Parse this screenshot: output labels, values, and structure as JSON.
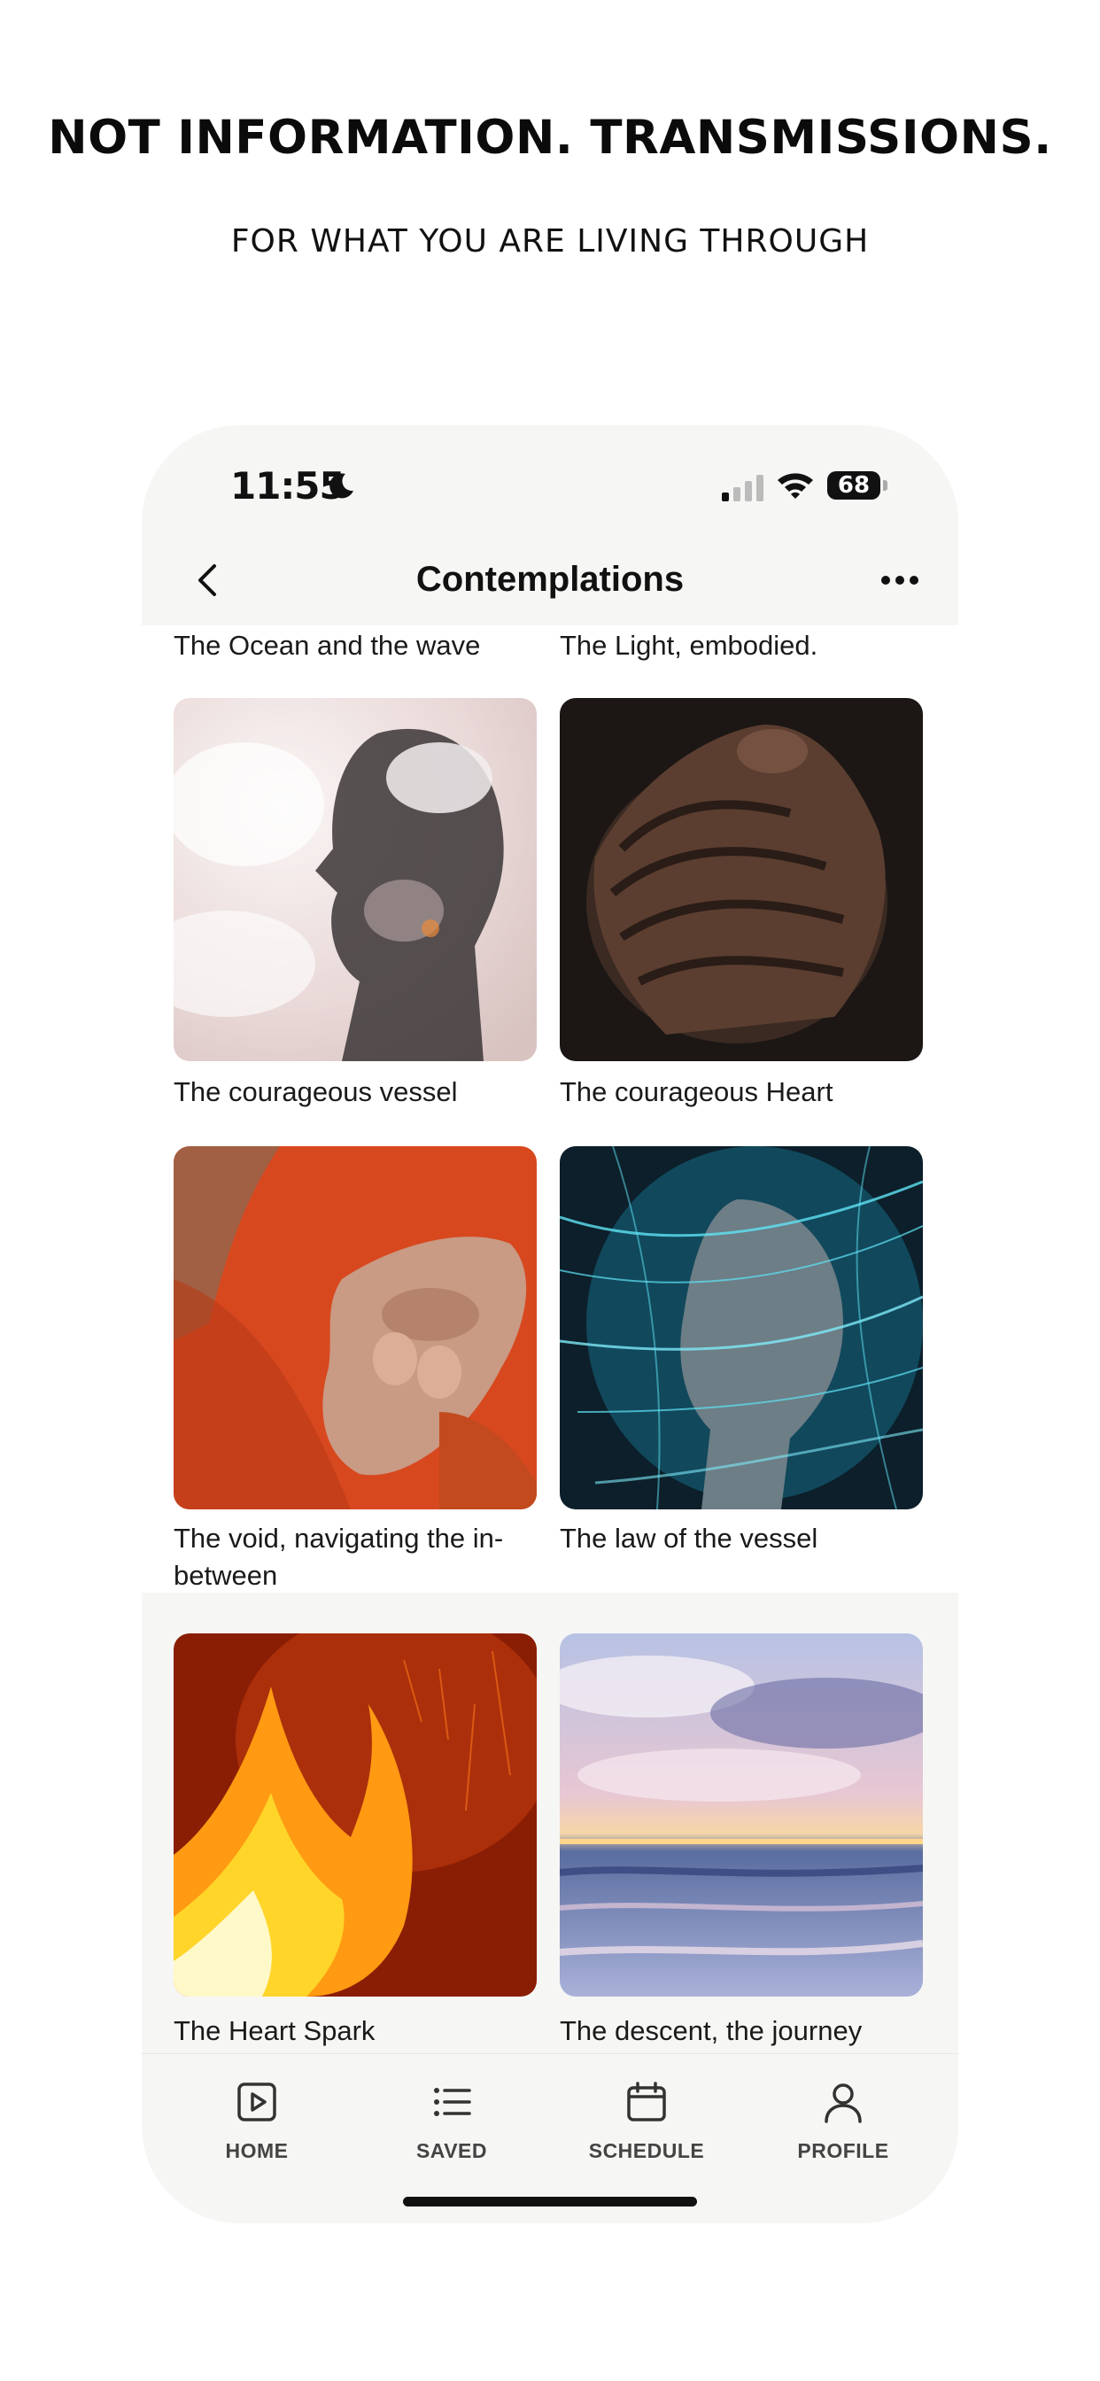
{
  "marketing": {
    "headline": "NOT INFORMATION. TRANSMISSIONS.",
    "subline": "FOR WHAT YOU ARE LIVING THROUGH"
  },
  "status_bar": {
    "time": "11:55",
    "battery": "68",
    "icons": [
      "moon-icon",
      "signal-icon",
      "wifi-icon",
      "battery-icon"
    ]
  },
  "nav": {
    "title": "Contemplations",
    "back_icon": "chevron-left-icon",
    "more_icon": "more-horizontal-icon"
  },
  "grid": {
    "top_labels": [
      "The Ocean and the wave",
      "The Light, embodied."
    ],
    "items": [
      {
        "label": "The courageous vessel",
        "image": "double-exposure-head-clouds"
      },
      {
        "label": "The courageous Heart",
        "image": "clasped-hands-dark"
      },
      {
        "label": "The void, navigating the in-between",
        "image": "open-hands-orange-robe"
      },
      {
        "label": "The law of the vessel",
        "image": "face-blue-light-strands"
      },
      {
        "label": "The Heart Spark",
        "image": "fire-sparks"
      },
      {
        "label": "The descent, the journey",
        "image": "ocean-sunset-sky"
      }
    ]
  },
  "tabbar": {
    "tabs": [
      {
        "label": "HOME",
        "icon": "play-square-icon"
      },
      {
        "label": "SAVED",
        "icon": "list-icon"
      },
      {
        "label": "SCHEDULE",
        "icon": "calendar-icon"
      },
      {
        "label": "PROFILE",
        "icon": "user-icon"
      }
    ]
  }
}
